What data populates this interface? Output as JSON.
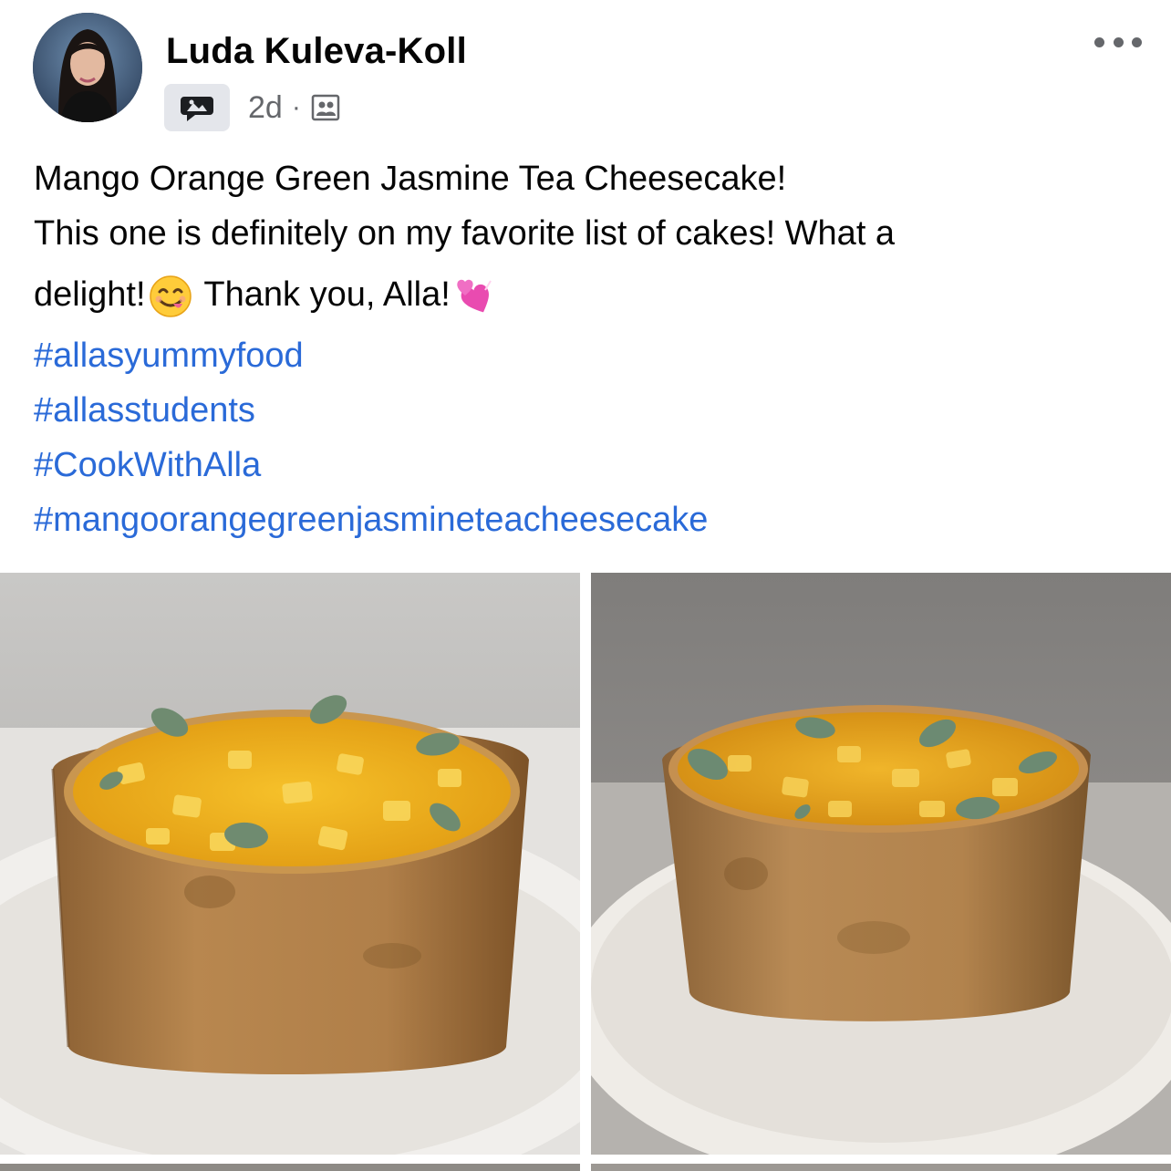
{
  "post": {
    "author": "Luda Kuleva-Koll",
    "time": "2d",
    "separator": "·",
    "group_icon": "group-chat-icon",
    "audience_icon": "group-members-icon",
    "more_icon": "more-options-icon",
    "text": {
      "line1": "Mango Orange Green Jasmine Tea Cheesecake!",
      "line2": "This one is definitely on my favorite list of cakes! What a",
      "line3_start": "delight!",
      "line3_emoji1": "yum-face-emoji",
      "line3_middle": " Thank you, Alla!",
      "line3_emoji2": "two-hearts-emoji"
    },
    "hashtags": [
      "#allasyummyfood",
      "#allasstudents",
      "#CookWithAlla",
      "#mangoorangegreenjasmineteacheesecake"
    ]
  },
  "colors": {
    "hashtag": "#2a6ad8",
    "secondary_text": "#65676b",
    "primary_text": "#050505"
  }
}
